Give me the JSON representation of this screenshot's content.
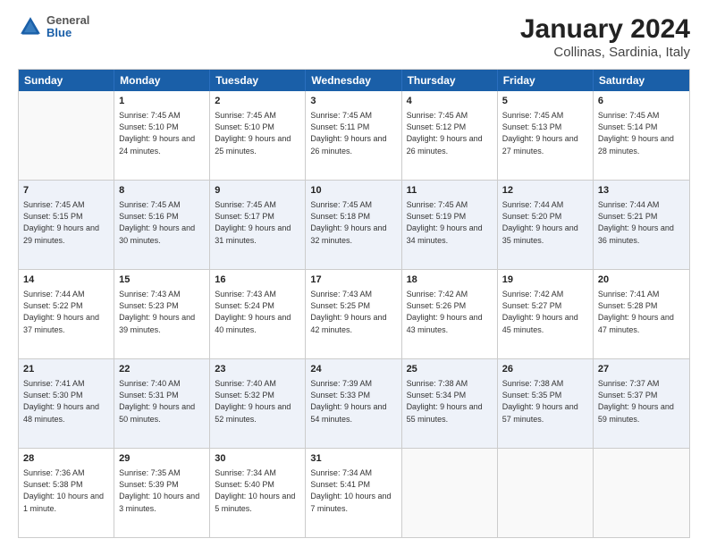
{
  "header": {
    "logo": {
      "general": "General",
      "blue": "Blue"
    },
    "title": "January 2024",
    "location": "Collinas, Sardinia, Italy"
  },
  "calendar": {
    "days_of_week": [
      "Sunday",
      "Monday",
      "Tuesday",
      "Wednesday",
      "Thursday",
      "Friday",
      "Saturday"
    ],
    "weeks": [
      [
        {
          "day": "",
          "empty": true
        },
        {
          "day": "1",
          "sunrise": "Sunrise: 7:45 AM",
          "sunset": "Sunset: 5:10 PM",
          "daylight": "Daylight: 9 hours and 24 minutes."
        },
        {
          "day": "2",
          "sunrise": "Sunrise: 7:45 AM",
          "sunset": "Sunset: 5:10 PM",
          "daylight": "Daylight: 9 hours and 25 minutes."
        },
        {
          "day": "3",
          "sunrise": "Sunrise: 7:45 AM",
          "sunset": "Sunset: 5:11 PM",
          "daylight": "Daylight: 9 hours and 26 minutes."
        },
        {
          "day": "4",
          "sunrise": "Sunrise: 7:45 AM",
          "sunset": "Sunset: 5:12 PM",
          "daylight": "Daylight: 9 hours and 26 minutes."
        },
        {
          "day": "5",
          "sunrise": "Sunrise: 7:45 AM",
          "sunset": "Sunset: 5:13 PM",
          "daylight": "Daylight: 9 hours and 27 minutes."
        },
        {
          "day": "6",
          "sunrise": "Sunrise: 7:45 AM",
          "sunset": "Sunset: 5:14 PM",
          "daylight": "Daylight: 9 hours and 28 minutes."
        }
      ],
      [
        {
          "day": "7",
          "sunrise": "Sunrise: 7:45 AM",
          "sunset": "Sunset: 5:15 PM",
          "daylight": "Daylight: 9 hours and 29 minutes."
        },
        {
          "day": "8",
          "sunrise": "Sunrise: 7:45 AM",
          "sunset": "Sunset: 5:16 PM",
          "daylight": "Daylight: 9 hours and 30 minutes."
        },
        {
          "day": "9",
          "sunrise": "Sunrise: 7:45 AM",
          "sunset": "Sunset: 5:17 PM",
          "daylight": "Daylight: 9 hours and 31 minutes."
        },
        {
          "day": "10",
          "sunrise": "Sunrise: 7:45 AM",
          "sunset": "Sunset: 5:18 PM",
          "daylight": "Daylight: 9 hours and 32 minutes."
        },
        {
          "day": "11",
          "sunrise": "Sunrise: 7:45 AM",
          "sunset": "Sunset: 5:19 PM",
          "daylight": "Daylight: 9 hours and 34 minutes."
        },
        {
          "day": "12",
          "sunrise": "Sunrise: 7:44 AM",
          "sunset": "Sunset: 5:20 PM",
          "daylight": "Daylight: 9 hours and 35 minutes."
        },
        {
          "day": "13",
          "sunrise": "Sunrise: 7:44 AM",
          "sunset": "Sunset: 5:21 PM",
          "daylight": "Daylight: 9 hours and 36 minutes."
        }
      ],
      [
        {
          "day": "14",
          "sunrise": "Sunrise: 7:44 AM",
          "sunset": "Sunset: 5:22 PM",
          "daylight": "Daylight: 9 hours and 37 minutes."
        },
        {
          "day": "15",
          "sunrise": "Sunrise: 7:43 AM",
          "sunset": "Sunset: 5:23 PM",
          "daylight": "Daylight: 9 hours and 39 minutes."
        },
        {
          "day": "16",
          "sunrise": "Sunrise: 7:43 AM",
          "sunset": "Sunset: 5:24 PM",
          "daylight": "Daylight: 9 hours and 40 minutes."
        },
        {
          "day": "17",
          "sunrise": "Sunrise: 7:43 AM",
          "sunset": "Sunset: 5:25 PM",
          "daylight": "Daylight: 9 hours and 42 minutes."
        },
        {
          "day": "18",
          "sunrise": "Sunrise: 7:42 AM",
          "sunset": "Sunset: 5:26 PM",
          "daylight": "Daylight: 9 hours and 43 minutes."
        },
        {
          "day": "19",
          "sunrise": "Sunrise: 7:42 AM",
          "sunset": "Sunset: 5:27 PM",
          "daylight": "Daylight: 9 hours and 45 minutes."
        },
        {
          "day": "20",
          "sunrise": "Sunrise: 7:41 AM",
          "sunset": "Sunset: 5:28 PM",
          "daylight": "Daylight: 9 hours and 47 minutes."
        }
      ],
      [
        {
          "day": "21",
          "sunrise": "Sunrise: 7:41 AM",
          "sunset": "Sunset: 5:30 PM",
          "daylight": "Daylight: 9 hours and 48 minutes."
        },
        {
          "day": "22",
          "sunrise": "Sunrise: 7:40 AM",
          "sunset": "Sunset: 5:31 PM",
          "daylight": "Daylight: 9 hours and 50 minutes."
        },
        {
          "day": "23",
          "sunrise": "Sunrise: 7:40 AM",
          "sunset": "Sunset: 5:32 PM",
          "daylight": "Daylight: 9 hours and 52 minutes."
        },
        {
          "day": "24",
          "sunrise": "Sunrise: 7:39 AM",
          "sunset": "Sunset: 5:33 PM",
          "daylight": "Daylight: 9 hours and 54 minutes."
        },
        {
          "day": "25",
          "sunrise": "Sunrise: 7:38 AM",
          "sunset": "Sunset: 5:34 PM",
          "daylight": "Daylight: 9 hours and 55 minutes."
        },
        {
          "day": "26",
          "sunrise": "Sunrise: 7:38 AM",
          "sunset": "Sunset: 5:35 PM",
          "daylight": "Daylight: 9 hours and 57 minutes."
        },
        {
          "day": "27",
          "sunrise": "Sunrise: 7:37 AM",
          "sunset": "Sunset: 5:37 PM",
          "daylight": "Daylight: 9 hours and 59 minutes."
        }
      ],
      [
        {
          "day": "28",
          "sunrise": "Sunrise: 7:36 AM",
          "sunset": "Sunset: 5:38 PM",
          "daylight": "Daylight: 10 hours and 1 minute."
        },
        {
          "day": "29",
          "sunrise": "Sunrise: 7:35 AM",
          "sunset": "Sunset: 5:39 PM",
          "daylight": "Daylight: 10 hours and 3 minutes."
        },
        {
          "day": "30",
          "sunrise": "Sunrise: 7:34 AM",
          "sunset": "Sunset: 5:40 PM",
          "daylight": "Daylight: 10 hours and 5 minutes."
        },
        {
          "day": "31",
          "sunrise": "Sunrise: 7:34 AM",
          "sunset": "Sunset: 5:41 PM",
          "daylight": "Daylight: 10 hours and 7 minutes."
        },
        {
          "day": "",
          "empty": true
        },
        {
          "day": "",
          "empty": true
        },
        {
          "day": "",
          "empty": true
        }
      ]
    ]
  }
}
